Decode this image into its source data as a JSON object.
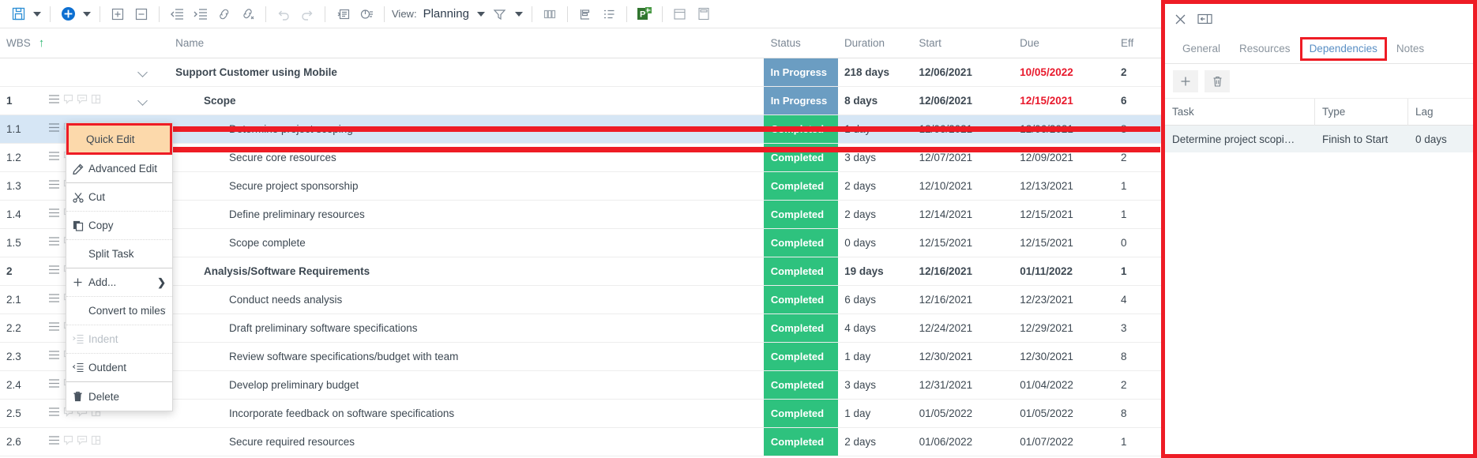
{
  "toolbar": {
    "view_label": "View:",
    "view_value": "Planning",
    "buttons": [
      {
        "name": "save-icon"
      },
      {
        "name": "save-dropdown-caret"
      },
      {
        "name": "add-task-icon"
      },
      {
        "name": "add-dropdown-caret"
      },
      {
        "name": "expand-all-icon"
      },
      {
        "name": "collapse-all-icon"
      },
      {
        "name": "outdent-icon"
      },
      {
        "name": "indent-icon"
      },
      {
        "name": "link-tasks-icon"
      },
      {
        "name": "unlink-tasks-icon"
      },
      {
        "name": "undo-icon"
      },
      {
        "name": "redo-icon"
      },
      {
        "name": "task-details-icon"
      },
      {
        "name": "percent-complete-icon"
      },
      {
        "name": "filter-icon"
      },
      {
        "name": "filter-dropdown-caret"
      },
      {
        "name": "columns-icon"
      },
      {
        "name": "baseline-icon"
      },
      {
        "name": "outline-icon"
      },
      {
        "name": "ms-project-export-icon"
      },
      {
        "name": "calendar-icon"
      },
      {
        "name": "calculator-icon"
      }
    ]
  },
  "grid": {
    "columns": [
      {
        "key": "wbs",
        "label": "WBS"
      },
      {
        "key": "name",
        "label": "Name"
      },
      {
        "key": "status",
        "label": "Status"
      },
      {
        "key": "duration",
        "label": "Duration"
      },
      {
        "key": "start",
        "label": "Start"
      },
      {
        "key": "due",
        "label": "Due"
      },
      {
        "key": "effort",
        "label": "Eff"
      }
    ],
    "sort_indicator": "↑",
    "rows": [
      {
        "wbs": "",
        "name": "Support Customer using Mobile",
        "status": "In Progress",
        "status_kind": "progress",
        "duration": "218 days",
        "start": "12/06/2021",
        "due": "10/05/2022",
        "due_late": true,
        "effort": "2",
        "bold": true,
        "indent": 0,
        "expander": true,
        "icons": false,
        "selected": false
      },
      {
        "wbs": "1",
        "name": "Scope",
        "status": "In Progress",
        "status_kind": "progress",
        "duration": "8 days",
        "start": "12/06/2021",
        "due": "12/15/2021",
        "due_late": true,
        "effort": "6",
        "bold": true,
        "indent": 1,
        "expander": true,
        "icons": true,
        "selected": false
      },
      {
        "wbs": "1.1",
        "name": "Determine project scoping",
        "status": "Completed",
        "status_kind": "done",
        "duration": "1 day",
        "start": "12/06/2021",
        "due": "12/06/2021",
        "due_late": false,
        "effort": "8",
        "bold": false,
        "indent": 2,
        "expander": false,
        "icons": true,
        "selected": true
      },
      {
        "wbs": "1.2",
        "name": "Secure core resources",
        "status": "Completed",
        "status_kind": "done",
        "duration": "3 days",
        "start": "12/07/2021",
        "due": "12/09/2021",
        "due_late": false,
        "effort": "2",
        "bold": false,
        "indent": 2,
        "expander": false,
        "icons": true,
        "selected": false
      },
      {
        "wbs": "1.3",
        "name": "Secure project sponsorship",
        "status": "Completed",
        "status_kind": "done",
        "duration": "2 days",
        "start": "12/10/2021",
        "due": "12/13/2021",
        "due_late": false,
        "effort": "1",
        "bold": false,
        "indent": 2,
        "expander": false,
        "icons": true,
        "selected": false
      },
      {
        "wbs": "1.4",
        "name": "Define preliminary resources",
        "status": "Completed",
        "status_kind": "done",
        "duration": "2 days",
        "start": "12/14/2021",
        "due": "12/15/2021",
        "due_late": false,
        "effort": "1",
        "bold": false,
        "indent": 2,
        "expander": false,
        "icons": true,
        "selected": false
      },
      {
        "wbs": "1.5",
        "name": "Scope complete",
        "status": "Completed",
        "status_kind": "done",
        "duration": "0 days",
        "start": "12/15/2021",
        "due": "12/15/2021",
        "due_late": false,
        "effort": "0",
        "bold": false,
        "indent": 2,
        "expander": false,
        "icons": true,
        "selected": false
      },
      {
        "wbs": "2",
        "name": "Analysis/Software Requirements",
        "status": "Completed",
        "status_kind": "done",
        "duration": "19 days",
        "start": "12/16/2021",
        "due": "01/11/2022",
        "due_late": false,
        "effort": "1",
        "bold": true,
        "indent": 1,
        "expander": true,
        "icons": true,
        "selected": false
      },
      {
        "wbs": "2.1",
        "name": "Conduct needs analysis",
        "status": "Completed",
        "status_kind": "done",
        "duration": "6 days",
        "start": "12/16/2021",
        "due": "12/23/2021",
        "due_late": false,
        "effort": "4",
        "bold": false,
        "indent": 2,
        "expander": false,
        "icons": true,
        "selected": false
      },
      {
        "wbs": "2.2",
        "name": "Draft preliminary software specifications",
        "status": "Completed",
        "status_kind": "done",
        "duration": "4 days",
        "start": "12/24/2021",
        "due": "12/29/2021",
        "due_late": false,
        "effort": "3",
        "bold": false,
        "indent": 2,
        "expander": false,
        "icons": true,
        "selected": false
      },
      {
        "wbs": "2.3",
        "name": "Review software specifications/budget with team",
        "status": "Completed",
        "status_kind": "done",
        "duration": "1 day",
        "start": "12/30/2021",
        "due": "12/30/2021",
        "due_late": false,
        "effort": "8",
        "bold": false,
        "indent": 2,
        "expander": false,
        "icons": true,
        "selected": false
      },
      {
        "wbs": "2.4",
        "name": "Develop preliminary budget",
        "status": "Completed",
        "status_kind": "done",
        "duration": "3 days",
        "start": "12/31/2021",
        "due": "01/04/2022",
        "due_late": false,
        "effort": "2",
        "bold": false,
        "indent": 2,
        "expander": false,
        "icons": true,
        "selected": false
      },
      {
        "wbs": "2.5",
        "name": "Incorporate feedback on software specifications",
        "status": "Completed",
        "status_kind": "done",
        "duration": "1 day",
        "start": "01/05/2022",
        "due": "01/05/2022",
        "due_late": false,
        "effort": "8",
        "bold": false,
        "indent": 2,
        "expander": false,
        "icons": true,
        "selected": false
      },
      {
        "wbs": "2.6",
        "name": "Secure required resources",
        "status": "Completed",
        "status_kind": "done",
        "duration": "2 days",
        "start": "01/06/2022",
        "due": "01/07/2022",
        "due_late": false,
        "effort": "1",
        "bold": false,
        "indent": 2,
        "expander": false,
        "icons": true,
        "selected": false
      }
    ]
  },
  "context_menu": {
    "items": [
      {
        "label": "Quick Edit",
        "icon": null,
        "highlight": true,
        "disabled": false,
        "submenu": false
      },
      {
        "label": "Advanced Edit",
        "icon": "pencil-icon",
        "highlight": false,
        "disabled": false,
        "submenu": false
      },
      {
        "label": "Cut",
        "icon": "scissors-icon",
        "highlight": false,
        "disabled": false,
        "submenu": false
      },
      {
        "label": "Copy",
        "icon": "copy-icon",
        "highlight": false,
        "disabled": false,
        "submenu": false
      },
      {
        "label": "Split Task",
        "icon": null,
        "highlight": false,
        "disabled": false,
        "submenu": false
      },
      {
        "label": "Add...",
        "icon": "plus-icon",
        "highlight": false,
        "disabled": false,
        "submenu": true
      },
      {
        "label": "Convert to milestone",
        "icon": null,
        "highlight": false,
        "disabled": false,
        "submenu": false
      },
      {
        "label": "Indent",
        "icon": "indent-icon",
        "highlight": false,
        "disabled": true,
        "submenu": false
      },
      {
        "label": "Outdent",
        "icon": "outdent-icon",
        "highlight": false,
        "disabled": false,
        "submenu": false
      },
      {
        "label": "Delete",
        "icon": "trash-icon",
        "highlight": false,
        "disabled": false,
        "submenu": false
      }
    ],
    "submenu_glyph": "❯"
  },
  "right_panel": {
    "close_icon": "close-icon",
    "collapse_icon": "collapse-panel-icon",
    "tabs": [
      {
        "label": "General",
        "active": false
      },
      {
        "label": "Resources",
        "active": false
      },
      {
        "label": "Dependencies",
        "active": true
      },
      {
        "label": "Notes",
        "active": false
      }
    ],
    "actions": [
      {
        "name": "add-dependency-button",
        "glyph": "+"
      },
      {
        "name": "delete-dependency-button",
        "glyph": "trash"
      }
    ],
    "dependencies": {
      "columns": [
        "Task",
        "Type",
        "Lag"
      ],
      "rows": [
        {
          "task": "Determine project scopi…",
          "type": "Finish to Start",
          "lag": "0 days"
        }
      ]
    }
  },
  "colors": {
    "accent_red": "#ee1c25",
    "status_in_progress": "#6b9dc2",
    "status_completed": "#2ec27e",
    "selected_row": "#d6e6f5",
    "highlight_bg": "#fcd9ab",
    "due_late": "#e8192c"
  }
}
